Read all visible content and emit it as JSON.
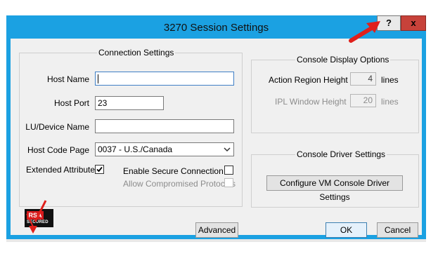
{
  "window": {
    "title": "3270 Session Settings",
    "help_label": "?",
    "close_label": "x"
  },
  "connection": {
    "group_title": "Connection Settings",
    "host_name_label": "Host Name",
    "host_name_value": "",
    "host_port_label": "Host Port",
    "host_port_value": "23",
    "lu_device_label": "LU/Device Name",
    "lu_device_value": "",
    "host_code_page_label": "Host Code Page",
    "host_code_page_value": "0037 - U.S./Canada",
    "extended_attributes_label": "Extended Attributes",
    "extended_attributes_checked": true,
    "secure_connection_label": "Enable Secure Connection",
    "secure_connection_checked": false,
    "compromised_protocols_label": "Allow Compromised Protocols",
    "compromised_protocols_checked": false
  },
  "console_display": {
    "group_title": "Console Display Options",
    "action_region_label": "Action Region Height",
    "action_region_value": "4",
    "action_region_unit": "lines",
    "ipl_window_label": "IPL Window Height",
    "ipl_window_value": "20",
    "ipl_window_unit": "lines"
  },
  "console_driver": {
    "group_title": "Console Driver Settings",
    "configure_button": "Configure VM Console Driver Settings"
  },
  "buttons": {
    "advanced": "Advanced",
    "ok": "OK",
    "cancel": "Cancel"
  },
  "logo": {
    "top": "RSA",
    "bottom": "SECURED"
  },
  "colors": {
    "titlebar": "#1ba1e2",
    "close": "#c7423a",
    "annotation_arrow": "#e0201b"
  }
}
